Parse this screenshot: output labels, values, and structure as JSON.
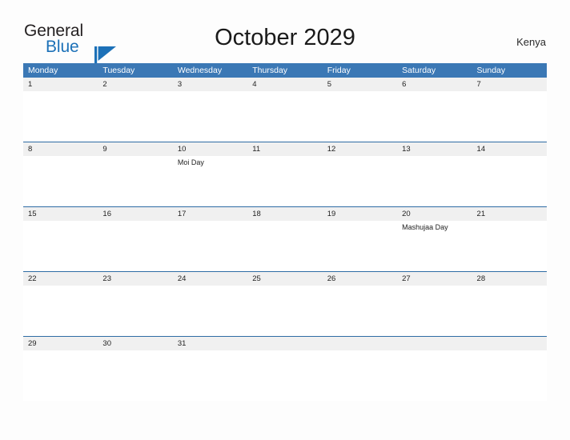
{
  "branding": {
    "line1": "General",
    "line2": "Blue",
    "flag_icon": "blue-flag-icon",
    "line1_color": "#231f20",
    "line2_color": "#1c71b8",
    "flag_color": "#1c71b8"
  },
  "header": {
    "title": "October 2029",
    "month": "October",
    "year": "2029",
    "region": "Kenya"
  },
  "theme": {
    "header_band": "#3b78b5",
    "row_divider": "#2e6ca4",
    "date_band": "#f0f0f0",
    "page_background": "#fdfdfd",
    "text": "#222222"
  },
  "weekdays": [
    "Monday",
    "Tuesday",
    "Wednesday",
    "Thursday",
    "Friday",
    "Saturday",
    "Sunday"
  ],
  "weeks": [
    {
      "days": [
        {
          "date": "1",
          "events": []
        },
        {
          "date": "2",
          "events": []
        },
        {
          "date": "3",
          "events": []
        },
        {
          "date": "4",
          "events": []
        },
        {
          "date": "5",
          "events": []
        },
        {
          "date": "6",
          "events": []
        },
        {
          "date": "7",
          "events": []
        }
      ]
    },
    {
      "days": [
        {
          "date": "8",
          "events": []
        },
        {
          "date": "9",
          "events": []
        },
        {
          "date": "10",
          "events": [
            "Moi Day"
          ]
        },
        {
          "date": "11",
          "events": []
        },
        {
          "date": "12",
          "events": []
        },
        {
          "date": "13",
          "events": []
        },
        {
          "date": "14",
          "events": []
        }
      ]
    },
    {
      "days": [
        {
          "date": "15",
          "events": []
        },
        {
          "date": "16",
          "events": []
        },
        {
          "date": "17",
          "events": []
        },
        {
          "date": "18",
          "events": []
        },
        {
          "date": "19",
          "events": []
        },
        {
          "date": "20",
          "events": [
            "Mashujaa Day"
          ]
        },
        {
          "date": "21",
          "events": []
        }
      ]
    },
    {
      "days": [
        {
          "date": "22",
          "events": []
        },
        {
          "date": "23",
          "events": []
        },
        {
          "date": "24",
          "events": []
        },
        {
          "date": "25",
          "events": []
        },
        {
          "date": "26",
          "events": []
        },
        {
          "date": "27",
          "events": []
        },
        {
          "date": "28",
          "events": []
        }
      ]
    },
    {
      "days": [
        {
          "date": "29",
          "events": []
        },
        {
          "date": "30",
          "events": []
        },
        {
          "date": "31",
          "events": []
        },
        {
          "date": "",
          "events": []
        },
        {
          "date": "",
          "events": []
        },
        {
          "date": "",
          "events": []
        },
        {
          "date": "",
          "events": []
        }
      ]
    }
  ]
}
